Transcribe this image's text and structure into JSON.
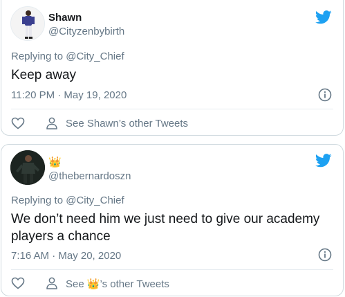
{
  "tweets": [
    {
      "display_name": "Shawn",
      "handle": "@Cityzenbybirth",
      "replying_prefix": "Replying to ",
      "replying_to": "@City_Chief",
      "text": "Keep away",
      "timestamp": "11:20 PM · May 19, 2020",
      "see_other": "See Shawn’s other Tweets"
    },
    {
      "display_name": "👑",
      "handle": "@thebernardoszn",
      "replying_prefix": "Replying to ",
      "replying_to": "@City_Chief",
      "text": "We don’t need him we just need to give our academy players a chance",
      "timestamp": "7:16 AM · May 20, 2020",
      "see_other_prefix": "See ",
      "see_other_name": "👑",
      "see_other_suffix": "’s other Tweets"
    }
  ],
  "colors": {
    "twitter_blue": "#1da1f2",
    "secondary_text": "#657786",
    "primary_text": "#14171a",
    "border": "#cfd9de"
  },
  "icons": {
    "brand": "twitter-bird-icon",
    "info": "info-icon",
    "like": "heart-icon",
    "profile": "person-icon"
  }
}
